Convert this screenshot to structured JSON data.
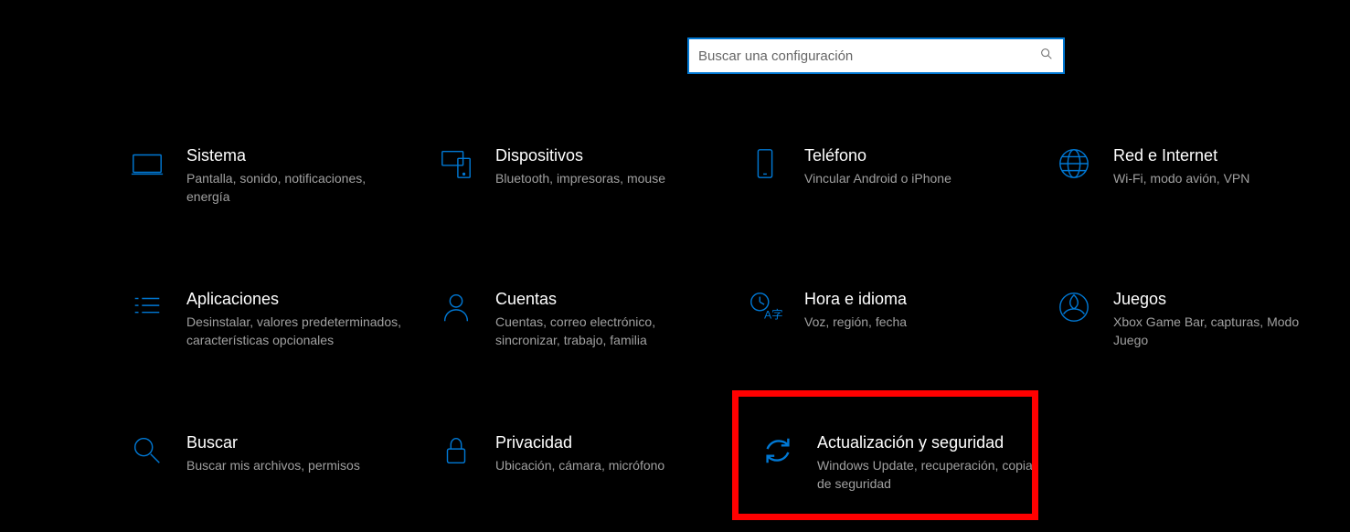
{
  "search": {
    "placeholder": "Buscar una configuración"
  },
  "tiles": {
    "system": {
      "title": "Sistema",
      "desc": "Pantalla, sonido, notificaciones, energía"
    },
    "devices": {
      "title": "Dispositivos",
      "desc": "Bluetooth, impresoras, mouse"
    },
    "phone": {
      "title": "Teléfono",
      "desc": "Vincular Android o iPhone"
    },
    "network": {
      "title": "Red e Internet",
      "desc": "Wi-Fi, modo avión, VPN"
    },
    "apps": {
      "title": "Aplicaciones",
      "desc": "Desinstalar, valores predeterminados, características opcionales"
    },
    "accounts": {
      "title": "Cuentas",
      "desc": "Cuentas, correo electrónico, sincronizar, trabajo, familia"
    },
    "time": {
      "title": "Hora e idioma",
      "desc": "Voz, región, fecha"
    },
    "gaming": {
      "title": "Juegos",
      "desc": "Xbox Game Bar, capturas, Modo Juego"
    },
    "search": {
      "title": "Buscar",
      "desc": "Buscar mis archivos, permisos"
    },
    "privacy": {
      "title": "Privacidad",
      "desc": "Ubicación, cámara, micrófono"
    },
    "update": {
      "title": "Actualización y seguridad",
      "desc": "Windows Update, recuperación, copia de seguridad"
    }
  }
}
